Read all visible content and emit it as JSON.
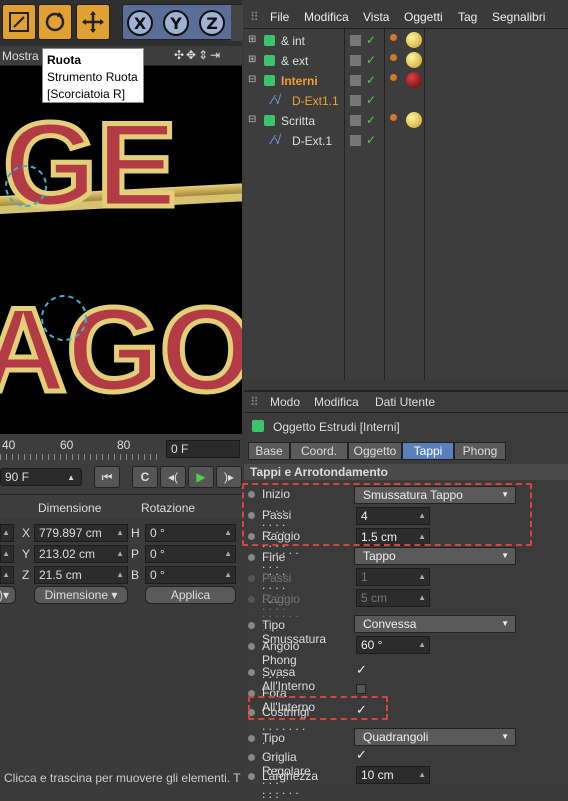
{
  "toolbar": {
    "tools": [
      "move-tool",
      "rotate-tool",
      "scale-tool"
    ],
    "axes": [
      "X",
      "Y",
      "Z"
    ]
  },
  "tooltip": {
    "title": "Ruota",
    "line1": "Strumento Ruota",
    "line2": "[Scorciatoia R]"
  },
  "viewport": {
    "label": "Mostra",
    "scene_text_top": "IGE",
    "scene_text_bottom": "AGO"
  },
  "timeline": {
    "ticks": [
      "40",
      "60",
      "80"
    ],
    "frame": "0 F",
    "end_frame": "90 F"
  },
  "coords": {
    "headers": {
      "dim": "Dimensione",
      "rot": "Rotazione"
    },
    "rows": [
      {
        "axis": "X",
        "value": "779.897 cm",
        "rlabel": "H",
        "rvalue": "0 °"
      },
      {
        "axis": "Y",
        "value": "213.02 cm",
        "rlabel": "P",
        "rvalue": "0 °"
      },
      {
        "axis": "Z",
        "value": "21.5 cm",
        "rlabel": "B",
        "rvalue": "0 °"
      }
    ],
    "mode": "Dimensione",
    "apply": "Applica"
  },
  "status": "Clicca e trascina per muovere gli elementi. T",
  "om": {
    "menu": [
      "File",
      "Modifica",
      "Vista",
      "Oggetti",
      "Tag",
      "Segnalibri"
    ],
    "objects": [
      {
        "name": "& int",
        "color": "#dddddd"
      },
      {
        "name": "& ext",
        "color": "#dddddd"
      },
      {
        "name": "Interni",
        "color": "#f0a030"
      },
      {
        "name": "D-Ext1.1",
        "color": "#f0a030"
      },
      {
        "name": "Scritta",
        "color": "#dddddd"
      },
      {
        "name": "D-Ext.1",
        "color": "#dddddd"
      }
    ]
  },
  "am": {
    "menu": [
      "Modo",
      "Modifica",
      "Dati Utente"
    ],
    "object_title": "Oggetto Estrudi [Interni]",
    "tabs": [
      "Base",
      "Coord.",
      "Oggetto",
      "Tappi",
      "Phong"
    ],
    "active_tab": "Tappi",
    "section": "Tappi e Arrotondamento",
    "rows": {
      "inizio": {
        "label": "Inizio . . . . . . . . . .",
        "value": "Smussatura Tappo"
      },
      "passi": {
        "label": "Passi . . . . . . . . . .",
        "value": "4"
      },
      "raggio": {
        "label": "Raggio . . . . . . . . .",
        "value": "1.5 cm"
      },
      "fine": {
        "label": "Fine . . . . . . . . . . .",
        "value": "Tappo"
      },
      "passi2": {
        "label": "Passi . . . . . . . . . .",
        "value": "1"
      },
      "raggio2": {
        "label": "Raggio . . . . . . . . .",
        "value": "5 cm"
      },
      "tipo_smuss": {
        "label": "Tipo Smussatura",
        "value": "Convessa"
      },
      "angolo": {
        "label": "Angolo Phong . . . .",
        "value": "60 °"
      },
      "svasa": {
        "label": "Svasa All'Interno"
      },
      "fora": {
        "label": "Fora All'Interno"
      },
      "costringi": {
        "label": "Costringi . . . . . . . ."
      },
      "tipo": {
        "label": "Tipo . . . . . . . . . . . .",
        "value": "Quadrangoli"
      },
      "griglia": {
        "label": "Griglia Regolare"
      },
      "larghezza": {
        "label": "Larghezza . . . . . .",
        "value": "10 cm"
      }
    },
    "check": "✓"
  }
}
